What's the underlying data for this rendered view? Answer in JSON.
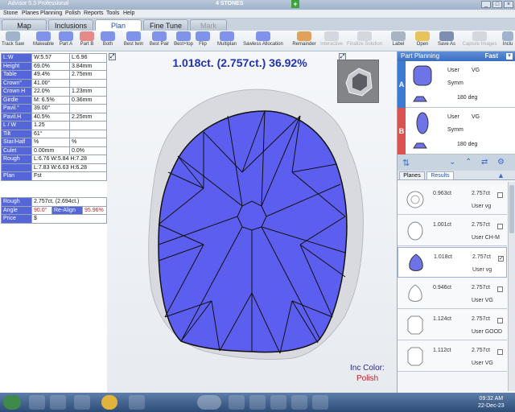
{
  "window": {
    "title": "Advisor 5.3 Professional",
    "center_title": "4 STONES"
  },
  "menu": [
    "Stone",
    "Planes",
    "Planning",
    "Polish",
    "Reports",
    "Tools",
    "Help"
  ],
  "tabs": [
    {
      "label": "Map"
    },
    {
      "label": "Inclusions"
    },
    {
      "label": "Plan"
    },
    {
      "label": "Fine Tune"
    },
    {
      "label": "Mark"
    }
  ],
  "toolbar": [
    "Track Saw",
    "Makeable",
    "Part A",
    "Part B",
    "Both",
    "Best twin",
    "Best Pair",
    "Best+top",
    "Flip",
    "Multiplan",
    "Sawless Allocation",
    "Remainder",
    "Interactive",
    "Finalize Solution",
    "Label",
    "Open",
    "Save As",
    "Capture Images",
    "Inclu"
  ],
  "params": [
    {
      "k": "L:W",
      "v": "W:5.57",
      "w": "L:6.96"
    },
    {
      "k": "Height",
      "v": "69.0%",
      "w": "3.84mm"
    },
    {
      "k": "Table",
      "v": "49.4%",
      "w": "2.75mm"
    },
    {
      "k": "Crown°",
      "v": "41.00°",
      "w": ""
    },
    {
      "k": "Crown H",
      "v": "22.0%",
      "w": "1.23mm"
    },
    {
      "k": "Girdle",
      "v": "M: 6.5%",
      "w": "0.36mm"
    },
    {
      "k": "Pavil.°",
      "v": "39.00°",
      "w": ""
    },
    {
      "k": "Pavil.H",
      "v": "40.5%",
      "w": "2.25mm"
    },
    {
      "k": "L / W",
      "v": "1.25",
      "w": ""
    },
    {
      "k": "Tilt",
      "v": "61°",
      "w": ""
    },
    {
      "k": "Star/Half",
      "v": "%",
      "w": "%"
    },
    {
      "k": "Culet",
      "v": "0.00mm",
      "w": "0.0%"
    },
    {
      "k": "Rough",
      "v": "L:6.76 W:5.84 H:7.28",
      "w": ""
    },
    {
      "k": "",
      "v": "L:7.83 W:6.63 H:6.28",
      "w": ""
    },
    {
      "k": "Plan",
      "v": "Fst",
      "w": ""
    }
  ],
  "summary": {
    "rough_label": "Rough",
    "rough_value": "2.757ct. (2.694ct.)",
    "angle_label": "Angle",
    "angle_value": "90.0°",
    "realign_label": "Re-Align",
    "realign_value": "95.96%",
    "price_label": "Price",
    "price_value": "$"
  },
  "view": {
    "heading": "1.018ct. (2.757ct.) 36.92%",
    "inc_label": "Inc Color:",
    "inc_value": "Polish"
  },
  "part_planning": {
    "title": "Part Planning",
    "mode": "Fast",
    "parts": [
      {
        "id": "A",
        "user": "User",
        "grade": "VG",
        "symm": "Symm",
        "angle": "180 deg",
        "color": "#3b7bd4"
      },
      {
        "id": "B",
        "user": "User",
        "grade": "VG",
        "symm": "Symm",
        "angle": "180 deg",
        "color": "#d9534f"
      }
    ]
  },
  "result_tabs": [
    "Planes",
    "Results"
  ],
  "results": [
    {
      "weight": "0.963ct",
      "total": "2.757ct",
      "grade": "User vg"
    },
    {
      "weight": "1.001ct",
      "total": "2.757ct",
      "grade": "User CH-M"
    },
    {
      "weight": "1.018ct",
      "total": "2.757ct",
      "grade": "User vg"
    },
    {
      "weight": "0.946ct",
      "total": "2.757ct",
      "grade": "User VG"
    },
    {
      "weight": "1.124ct",
      "total": "2.757ct",
      "grade": "User GOOD"
    },
    {
      "weight": "1.112ct",
      "total": "2.757ct",
      "grade": "User VG"
    }
  ],
  "clock": {
    "time": "09:32 AM",
    "date": "22-Dec-23"
  }
}
